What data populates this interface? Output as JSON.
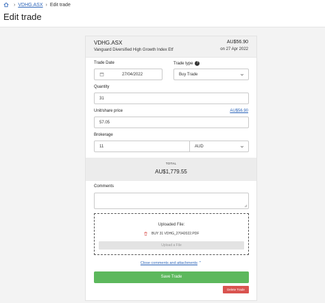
{
  "breadcrumb": {
    "link": "VDHG.ASX",
    "current": "Edit trade"
  },
  "page": {
    "title": "Edit trade"
  },
  "holding": {
    "symbol": "VDHG.ASX",
    "name": "Vanguard Diversified High Growth Index Etf",
    "price": "AU$56.90",
    "price_date": "on 27 Apr 2022"
  },
  "form": {
    "trade_date_label": "Trade Date",
    "trade_date_value": "27/04/2022",
    "trade_type_label": "Trade type",
    "trade_type_help": "?",
    "trade_type_value": "Buy Trade",
    "quantity_label": "Quantity",
    "quantity_value": "31",
    "unit_price_label": "Unit/share price",
    "unit_price_link": "AU$56.90",
    "unit_price_value": "57.05",
    "brokerage_label": "Brokerage",
    "brokerage_value": "11",
    "currency_value": "AUD"
  },
  "total": {
    "label": "TOTAL",
    "value": "AU$1,779.55"
  },
  "comments": {
    "label": "Comments",
    "value": ""
  },
  "upload": {
    "title": "Uploaded File:",
    "file_name": "BUY 31 VDHG_27042022.PDF",
    "button_label": "Upload a File"
  },
  "actions": {
    "close_link": "Close comments and attachments",
    "save_label": "Save Trade",
    "delete_label": "Delete Trade"
  },
  "colors": {
    "link": "#2a63b8",
    "save": "#5cb85c",
    "delete": "#d9534f"
  }
}
